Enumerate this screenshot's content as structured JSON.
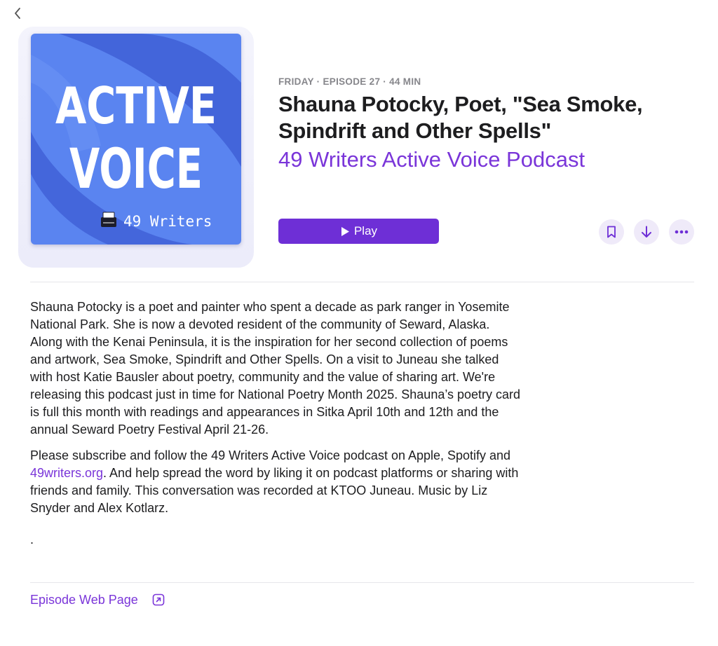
{
  "icons": {
    "back": "chevron-left-icon",
    "play": "play-icon",
    "bookmark": "bookmark-icon",
    "download": "arrow-down-icon",
    "more": "ellipsis-icon",
    "external": "external-link-icon"
  },
  "colors": {
    "accent": "#7a35d9",
    "play_button": "#6e2fd6",
    "artwork_blue": "#5a84f0",
    "artwork_dark_blue": "#3f5fd6",
    "eyebrow": "#86868b",
    "icon_button_bg": "#efeaf9"
  },
  "artwork": {
    "line1": "ACTIVE",
    "line2": "VOICE",
    "brand": "49 Writers"
  },
  "episode": {
    "eyebrow": "FRIDAY · EPISODE 27 · 44 MIN",
    "title_line1": "Shauna Potocky, Poet, \"Sea Smoke,",
    "title_line2": "Spindrift and Other Spells\"",
    "show": "49 Writers Active Voice Podcast",
    "play_label": "Play"
  },
  "description": {
    "paragraph1": "Shauna Potocky is a poet and painter who spent a decade as park ranger in Yosemite National Park. She is now a devoted resident of the community of Seward, Alaska. Along with the Kenai Peninsula, it is the inspiration for her second collection of poems and artwork, Sea Smoke, Spindrift and Other Spells. On a visit to Juneau she talked with host Katie Bausler about poetry, community and the value of sharing art. We're releasing this podcast just in time for National Poetry Month 2025. Shauna’s poetry card is full this month with readings and appearances in Sitka April 10th and 12th  and the annual Seward Poetry Festival April 21-26.",
    "paragraph2_before": "Please subscribe and follow the 49 Writers Active Voice podcast on Apple, Spotify and ",
    "paragraph2_link": "49writers.org",
    "paragraph2_after": ". And help spread the word by liking it on podcast platforms or sharing with friends and family. This conversation was recorded at KTOO Juneau. Music by Liz Snyder and Alex Kotlarz.",
    "trailing": "."
  },
  "footer": {
    "web_page_label": "Episode Web Page"
  }
}
